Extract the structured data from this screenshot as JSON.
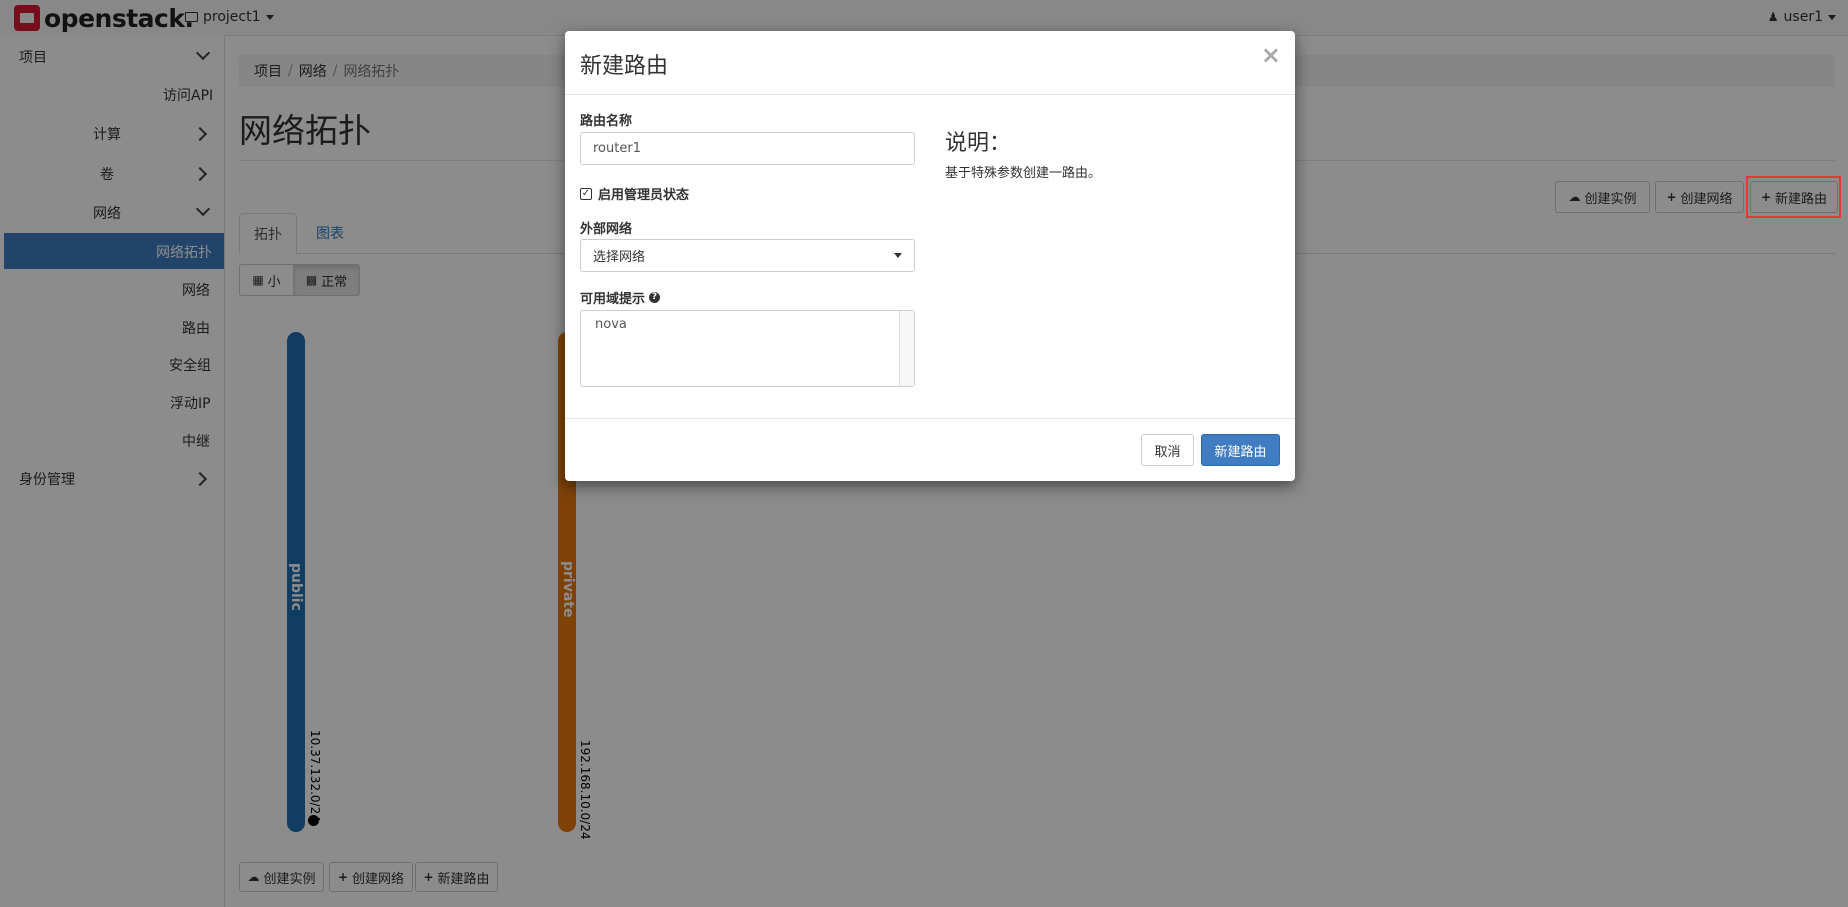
{
  "navbar": {
    "brand": "openstack.",
    "project": "project1",
    "user": "user1"
  },
  "sidebar": {
    "project": "项目",
    "access_api": "访问API",
    "compute": "计算",
    "volumes": "卷",
    "network": "网络",
    "network_topology": "网络拓扑",
    "networks": "网络",
    "routers": "路由",
    "security_groups": "安全组",
    "floating_ips": "浮动IP",
    "trunks": "中继",
    "identity": "身份管理"
  },
  "breadcrumb": [
    "项目",
    "网络",
    "网络拓扑"
  ],
  "breadcrumb_sep": "/",
  "page_title": "网络拓扑",
  "actions": {
    "launch_instance": "创建实例",
    "create_network": "创建网络",
    "create_router": "新建路由"
  },
  "tabs": {
    "topology": "拓扑",
    "graph": "图表"
  },
  "view_toggle": {
    "small": "小",
    "normal": "正常"
  },
  "networks": [
    {
      "name": "public",
      "cidr": "10.37.132.0/24",
      "color": "#1f6fb2"
    },
    {
      "name": "private",
      "cidr": "192.168.10.0/24",
      "color": "#e5780e"
    }
  ],
  "modal": {
    "title": "新建路由",
    "close": "×",
    "router_name_label": "路由名称",
    "router_name_value": "router1",
    "admin_state_label": "启用管理员状态",
    "external_network_label": "外部网络",
    "external_network_value": "选择网络",
    "az_hint_label": "可用域提示",
    "az_hint_value": "nova",
    "desc_title": "说明：",
    "desc_text": "基于特殊参数创建一路由。",
    "cancel": "取消",
    "submit": "新建路由"
  }
}
